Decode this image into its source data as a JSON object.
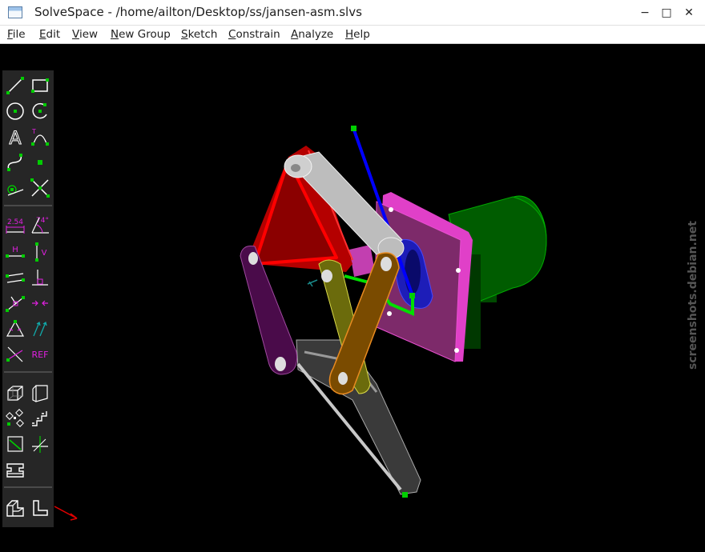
{
  "window": {
    "title": "SolveSpace - /home/ailton/Desktop/ss/jansen-asm.slvs",
    "controls": [
      "✕",
      "□",
      "−"
    ]
  },
  "menu": [
    {
      "label": "File",
      "u": "F",
      "rest": "ile"
    },
    {
      "label": "Edit",
      "u": "E",
      "rest": "dit"
    },
    {
      "label": "View",
      "u": "V",
      "rest": "iew"
    },
    {
      "label": "New Group",
      "u": "N",
      "rest": "ew Group"
    },
    {
      "label": "Sketch",
      "u": "S",
      "rest": "ketch"
    },
    {
      "label": "Constrain",
      "u": "C",
      "rest": "onstrain"
    },
    {
      "label": "Analyze",
      "u": "A",
      "rest": "nalyze"
    },
    {
      "label": "Help",
      "u": "H",
      "rest": "elp"
    }
  ],
  "toolbar": {
    "dimension_label": "2.54",
    "angle_label": "74°",
    "horizontal_label": "H",
    "vertical_label": "V",
    "reference_label": "REF",
    "text_label": "A",
    "text_curve_label": "T"
  },
  "watermark": {
    "text": "screenshots.debian.net"
  },
  "colors": {
    "sketch_green": "#00c800",
    "constraint_magenta": "#ff00ff",
    "triangle_red": "#8b0000",
    "link_purple": "#4a0b4a",
    "link_olive": "#6b6b0c",
    "link_orange": "#7a4b00",
    "plate_magenta": "#7d2a6a",
    "motor_green": "#005a00"
  }
}
